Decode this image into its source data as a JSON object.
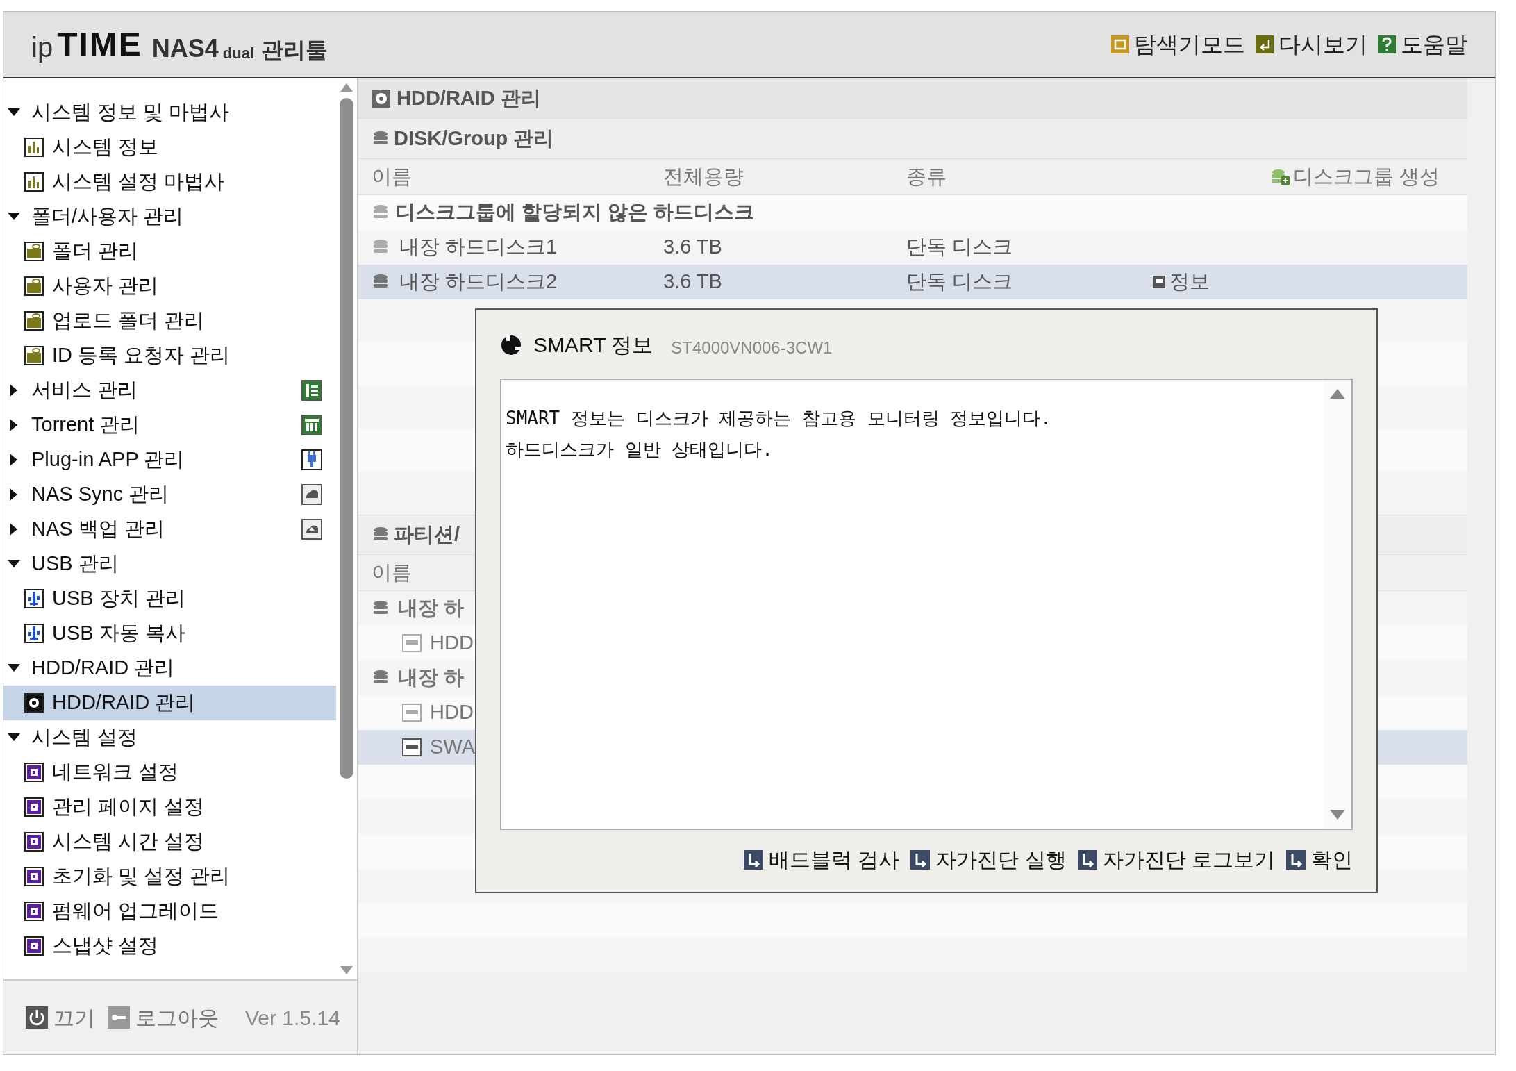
{
  "header": {
    "logo": {
      "brand_a": "ip",
      "brand_b": "TIME",
      "product": "NAS4",
      "product_sub": "dual",
      "suffix": "관리툴"
    },
    "links": [
      {
        "label": "탐색기모드",
        "kind": "explorer"
      },
      {
        "label": "다시보기",
        "kind": "refresh"
      },
      {
        "label": "도움말",
        "kind": "help"
      }
    ]
  },
  "sidebar": {
    "items": [
      {
        "label": "시스템 정보 및 마법사",
        "expanded": true,
        "children": [
          {
            "label": "시스템 정보",
            "kind": "chart",
            "selected": false
          },
          {
            "label": "시스템 설정 마법사",
            "kind": "chart",
            "selected": false
          }
        ]
      },
      {
        "label": "폴더/사용자 관리",
        "expanded": true,
        "children": [
          {
            "label": "폴더 관리",
            "kind": "folder",
            "selected": false
          },
          {
            "label": "사용자 관리",
            "kind": "folder",
            "selected": false
          },
          {
            "label": "업로드 폴더 관리",
            "kind": "folder",
            "selected": false
          },
          {
            "label": "ID 등록 요청자 관리",
            "kind": "folder",
            "selected": false
          }
        ]
      },
      {
        "label": "서비스 관리",
        "expanded": false,
        "kind": "service"
      },
      {
        "label": "Torrent 관리",
        "expanded": false,
        "kind": "torrent"
      },
      {
        "label": "Plug-in APP 관리",
        "expanded": false,
        "kind": "plugin"
      },
      {
        "label": "NAS Sync 관리",
        "expanded": false,
        "kind": "sync"
      },
      {
        "label": "NAS 백업 관리",
        "expanded": false,
        "kind": "backup"
      },
      {
        "label": "USB 관리",
        "expanded": true,
        "children": [
          {
            "label": "USB 장치 관리",
            "kind": "usb",
            "selected": false
          },
          {
            "label": "USB 자동 복사",
            "kind": "usb",
            "selected": false
          }
        ]
      },
      {
        "label": "HDD/RAID 관리",
        "expanded": true,
        "children": [
          {
            "label": "HDD/RAID 관리",
            "kind": "disk",
            "selected": true
          }
        ]
      },
      {
        "label": "시스템 설정",
        "expanded": true,
        "children": [
          {
            "label": "네트워크 설정",
            "kind": "gear",
            "selected": false
          },
          {
            "label": "관리 페이지 설정",
            "kind": "gear",
            "selected": false
          },
          {
            "label": "시스템 시간 설정",
            "kind": "gear",
            "selected": false
          },
          {
            "label": "초기화 및 설정 관리",
            "kind": "gear",
            "selected": false
          },
          {
            "label": "펌웨어 업그레이드",
            "kind": "gear",
            "selected": false
          },
          {
            "label": "스냅샷 설정",
            "kind": "gear",
            "selected": false
          }
        ]
      }
    ],
    "footer": {
      "buttons": [
        {
          "label": "끄기",
          "kind": "power"
        },
        {
          "label": "로그아웃",
          "kind": "key"
        }
      ],
      "version": "Ver 1.5.14"
    }
  },
  "main": {
    "title": "HDD/RAID 관리",
    "disk_group": {
      "title": "DISK/Group 관리",
      "columns": [
        "이름",
        "전체용량",
        "종류"
      ],
      "create_label": "디스크그룹 생성",
      "group_label": "디스크그룹에 할당되지 않은 하드디스크",
      "disks": [
        {
          "name": "내장 하드디스크1",
          "capacity": "3.6 TB",
          "type": "단독 디스크",
          "selected": false
        },
        {
          "name": "내장 하드디스크2",
          "capacity": "3.6 TB",
          "type": "단독 디스크",
          "info_label": "정보",
          "selected": true
        }
      ]
    },
    "partition": {
      "title": "파티션/",
      "column": "이름",
      "rows": [
        {
          "label": "내장 하",
          "kind": "group",
          "selected": false
        },
        {
          "label": "HDD",
          "kind": "item",
          "selected": false
        },
        {
          "label": "내장 하",
          "kind": "group",
          "selected": false
        },
        {
          "label": "HDD",
          "kind": "item",
          "selected": false
        },
        {
          "label": "SWA",
          "kind": "item",
          "selected": true
        }
      ]
    }
  },
  "dialog": {
    "title": "SMART 정보",
    "model": "ST4000VN006-3CW1",
    "message": [
      "SMART 정보는 디스크가 제공하는 참고용 모니터링 정보입니다.",
      "하드디스크가 일반 상태입니다."
    ],
    "buttons": [
      "배드블럭 검사",
      "자가진단 실행",
      "자가진단 로그보기",
      "확인"
    ]
  }
}
